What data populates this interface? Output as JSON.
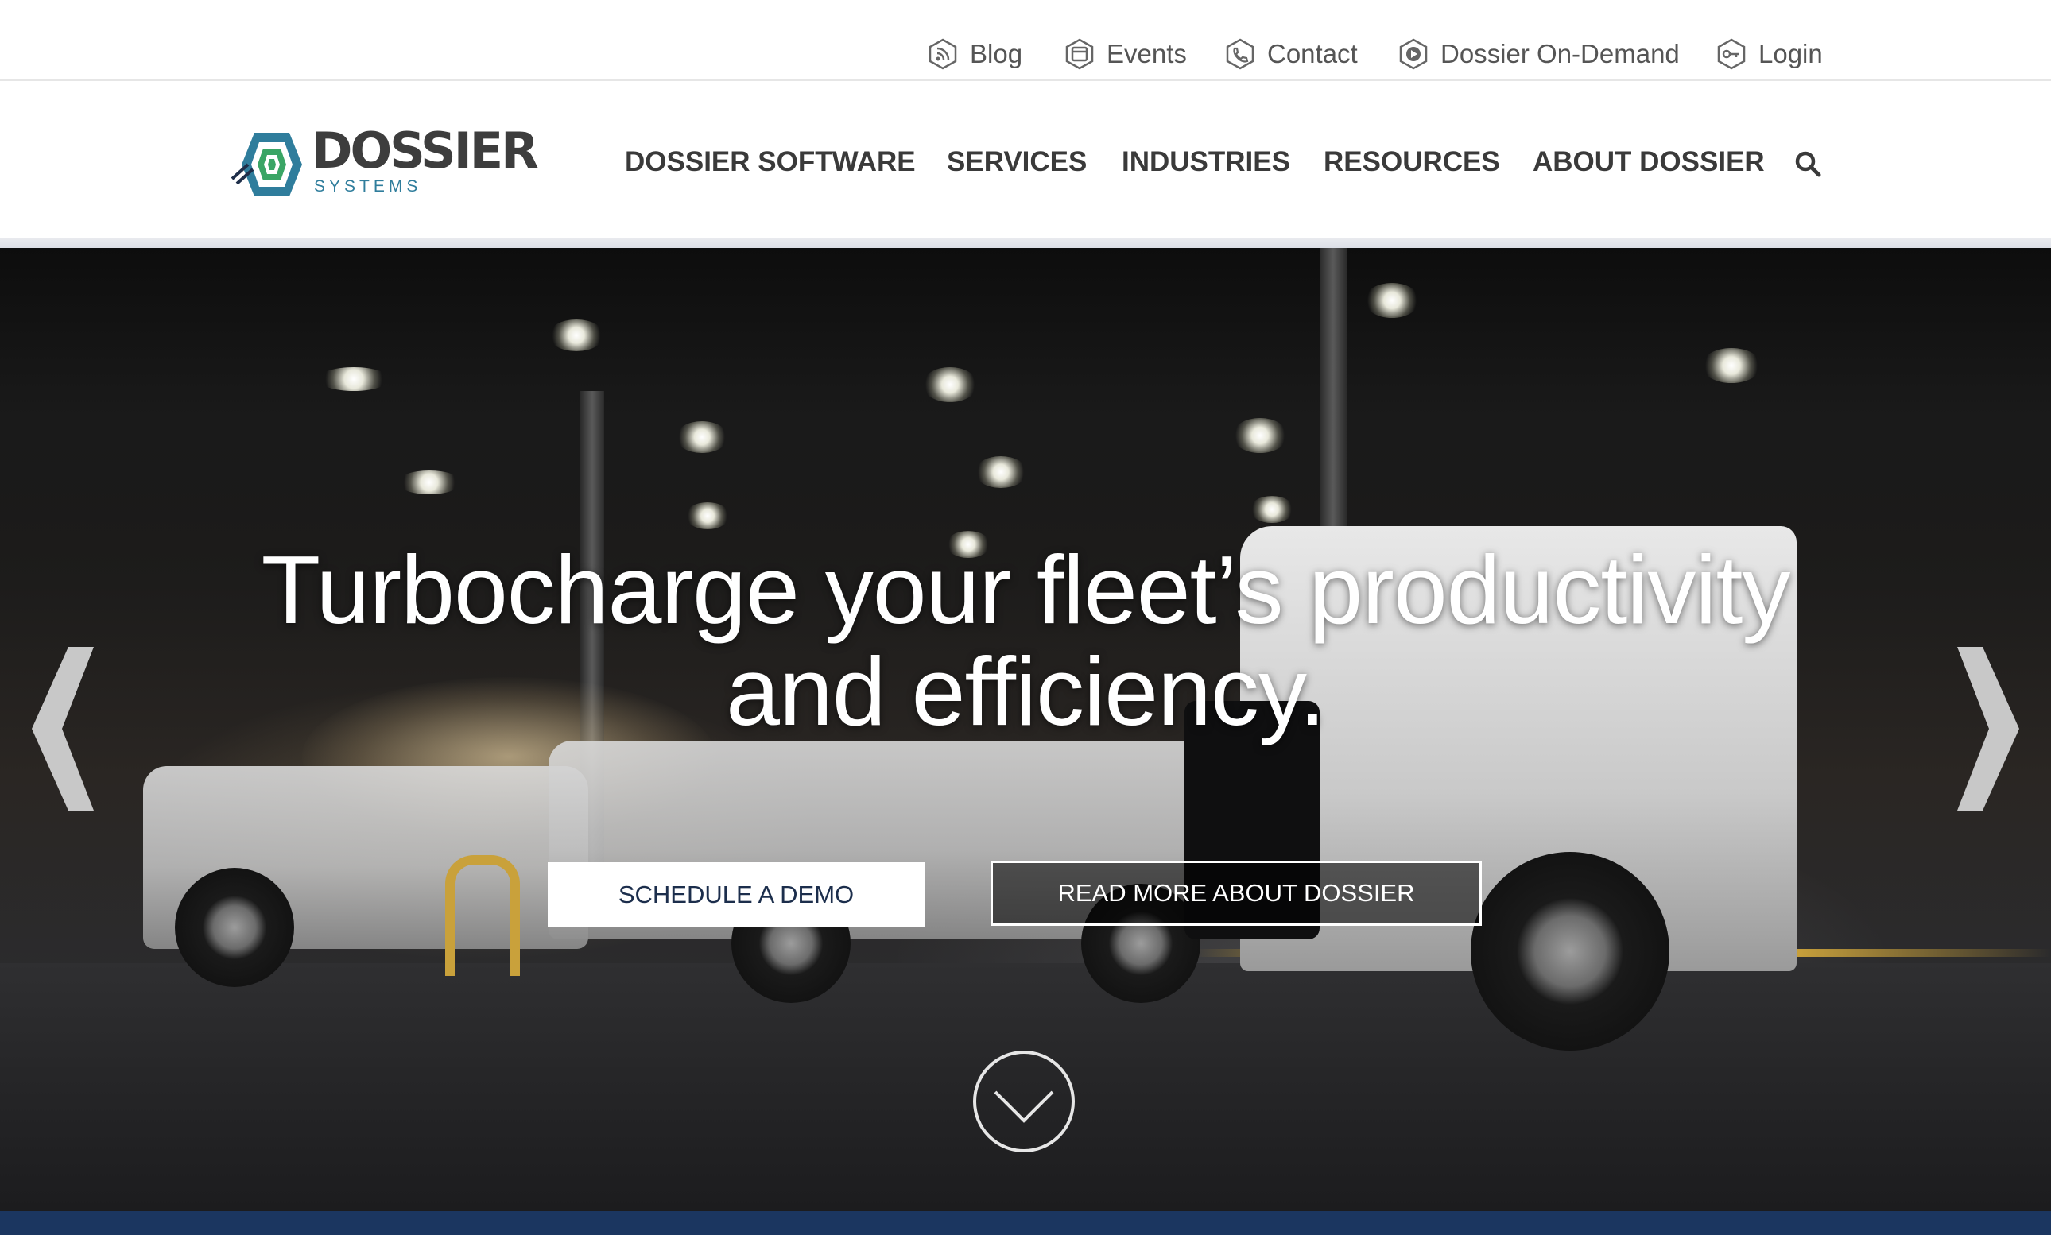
{
  "utility_nav": {
    "items": [
      {
        "label": "Blog",
        "icon": "rss-icon"
      },
      {
        "label": "Events",
        "icon": "calendar-icon"
      },
      {
        "label": "Contact",
        "icon": "phone-icon"
      },
      {
        "label": "Dossier On-Demand",
        "icon": "play-icon"
      },
      {
        "label": "Login",
        "icon": "key-icon"
      }
    ]
  },
  "brand": {
    "name": "DOSSIER",
    "tagline": "SYSTEMS"
  },
  "main_nav": {
    "items": [
      {
        "label": "DOSSIER SOFTWARE"
      },
      {
        "label": "SERVICES"
      },
      {
        "label": "INDUSTRIES"
      },
      {
        "label": "RESOURCES"
      },
      {
        "label": "ABOUT DOSSIER"
      }
    ],
    "search_icon": "search-icon"
  },
  "hero": {
    "heading_line1": "Turbocharge your fleet’s productivity",
    "heading_line2": "and efficiency.",
    "primary_cta": "SCHEDULE A DEMO",
    "secondary_cta": "READ MORE ABOUT DOSSIER",
    "prev_icon": "chevron-left-icon",
    "next_icon": "chevron-right-icon",
    "scroll_icon": "chevron-down-circle-icon"
  },
  "colors": {
    "nav_text": "#3a3a3a",
    "utility_text": "#555555",
    "brand_teal": "#2f7d9c",
    "demo_button_text": "#1c2e4c",
    "footer_band": "#1b3660"
  }
}
